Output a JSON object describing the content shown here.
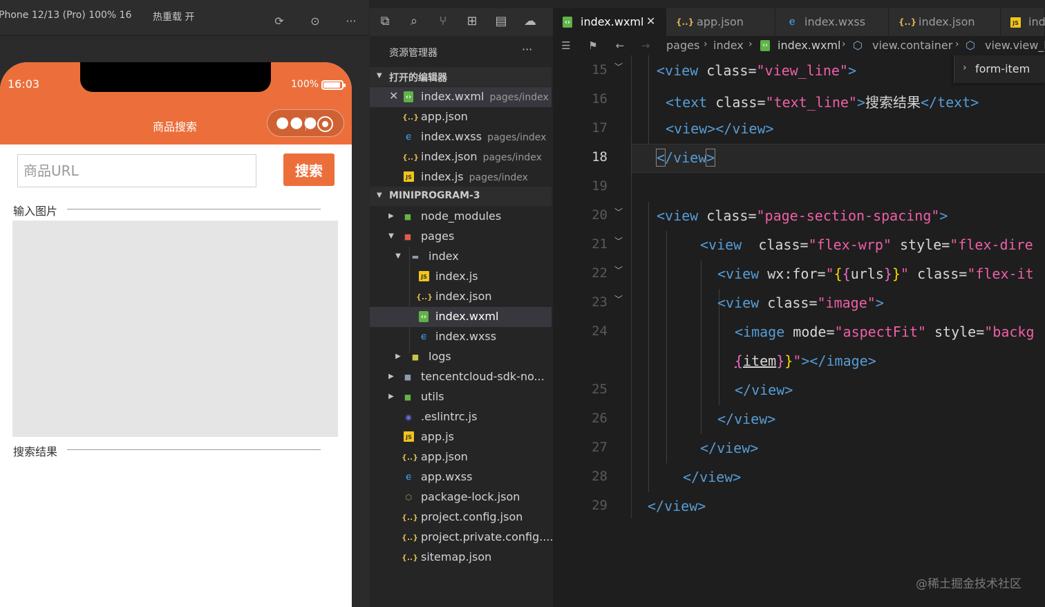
{
  "simulator": {
    "device_label": "Phone 12/13 (Pro) 100% 16",
    "hot_reload_label": "热重载 开",
    "status": {
      "time": "16:03",
      "battery": "100%"
    },
    "nav_title": "商品搜索",
    "capsule": {
      "more_icon": "ellipsis-icon",
      "close_icon": "target-icon"
    },
    "url_placeholder": "商品URL",
    "search_button": "搜索",
    "section_input_image": "输入图片",
    "section_search_result": "搜索结果"
  },
  "explorer": {
    "title": "资源管理器",
    "more": "···",
    "open_editors_label": "打开的编辑器",
    "open_editors": [
      {
        "name": "index.wxml",
        "desc": "pages/index",
        "icon": "wxml-icon"
      },
      {
        "name": "app.json",
        "desc": "",
        "icon": "json-icon"
      },
      {
        "name": "index.wxss",
        "desc": "pages/index",
        "icon": "css-icon"
      },
      {
        "name": "index.json",
        "desc": "pages/index",
        "icon": "json-icon"
      },
      {
        "name": "index.js",
        "desc": "pages/index",
        "icon": "js-icon"
      }
    ],
    "project_label": "MINIPROGRAM-3",
    "tree": [
      {
        "name": "node_modules",
        "icon": "folder-icon"
      },
      {
        "name": "pages",
        "icon": "folder-icon"
      },
      {
        "name": "index",
        "icon": "folder-open-icon"
      },
      {
        "name": "index.js",
        "icon": "js-icon"
      },
      {
        "name": "index.json",
        "icon": "json-icon"
      },
      {
        "name": "index.wxml",
        "icon": "wxml-icon"
      },
      {
        "name": "index.wxss",
        "icon": "css-icon"
      },
      {
        "name": "logs",
        "icon": "folder-icon"
      },
      {
        "name": "tencentcloud-sdk-no...",
        "icon": "folder-icon"
      },
      {
        "name": "utils",
        "icon": "folder-icon"
      },
      {
        "name": ".eslintrc.js",
        "icon": "eslint-icon"
      },
      {
        "name": "app.js",
        "icon": "js-icon"
      },
      {
        "name": "app.json",
        "icon": "json-icon"
      },
      {
        "name": "app.wxss",
        "icon": "css-icon"
      },
      {
        "name": "package-lock.json",
        "icon": "npm-icon"
      },
      {
        "name": "project.config.json",
        "icon": "json-icon"
      },
      {
        "name": "project.private.config....",
        "icon": "json-icon"
      },
      {
        "name": "sitemap.json",
        "icon": "json-icon"
      }
    ]
  },
  "editor": {
    "tabs": [
      {
        "label": "index.wxml",
        "icon": "wxml-icon",
        "active": true
      },
      {
        "label": "app.json",
        "icon": "json-icon"
      },
      {
        "label": "index.wxss",
        "icon": "css-icon"
      },
      {
        "label": "index.json",
        "icon": "json-icon"
      },
      {
        "label": "ind",
        "icon": "js-icon"
      }
    ],
    "breadcrumb": [
      "pages",
      "index",
      "index.wxml",
      "view.container",
      "view.view_li"
    ],
    "sticky_scroll": "form-item",
    "line_numbers": [
      "15",
      "16",
      "17",
      "18",
      "19",
      "20",
      "21",
      "22",
      "23",
      "24",
      "25",
      "26",
      "27",
      "28",
      "29"
    ],
    "current_line": "18"
  },
  "watermark": "@稀土掘金技术社区"
}
